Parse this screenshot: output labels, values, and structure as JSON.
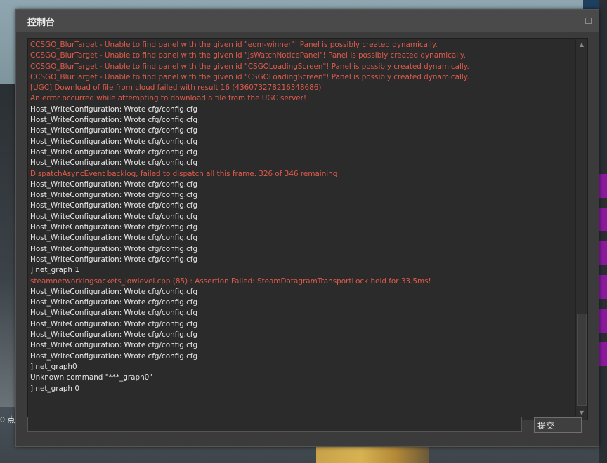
{
  "window": {
    "title": "控制台"
  },
  "log": [
    {
      "text": "CCSGO_BlurTarget - Unable to find panel with the given id \"eom-winner\"! Panel is possibly created dynamically.",
      "type": "error"
    },
    {
      "text": "CCSGO_BlurTarget - Unable to find panel with the given id \"JsWatchNoticePanel\"! Panel is possibly created dynamically.",
      "type": "error"
    },
    {
      "text": "CCSGO_BlurTarget - Unable to find panel with the given id \"CSGOLoadingScreen\"! Panel is possibly created dynamically.",
      "type": "error"
    },
    {
      "text": "CCSGO_BlurTarget - Unable to find panel with the given id \"CSGOLoadingScreen\"! Panel is possibly created dynamically.",
      "type": "error"
    },
    {
      "text": "[UGC] Download of file  from cloud failed with result 16 (436073278216348686)",
      "type": "error"
    },
    {
      "text": "An error occurred while attempting to download a file from the UGC server!",
      "type": "error"
    },
    {
      "text": "Host_WriteConfiguration: Wrote cfg/config.cfg",
      "type": "normal"
    },
    {
      "text": "Host_WriteConfiguration: Wrote cfg/config.cfg",
      "type": "normal"
    },
    {
      "text": "Host_WriteConfiguration: Wrote cfg/config.cfg",
      "type": "normal"
    },
    {
      "text": "Host_WriteConfiguration: Wrote cfg/config.cfg",
      "type": "normal"
    },
    {
      "text": "Host_WriteConfiguration: Wrote cfg/config.cfg",
      "type": "normal"
    },
    {
      "text": "Host_WriteConfiguration: Wrote cfg/config.cfg",
      "type": "normal"
    },
    {
      "text": "DispatchAsyncEvent backlog, failed to dispatch all this frame. 326 of 346 remaining",
      "type": "error"
    },
    {
      "text": "Host_WriteConfiguration: Wrote cfg/config.cfg",
      "type": "normal"
    },
    {
      "text": "Host_WriteConfiguration: Wrote cfg/config.cfg",
      "type": "normal"
    },
    {
      "text": "Host_WriteConfiguration: Wrote cfg/config.cfg",
      "type": "normal"
    },
    {
      "text": "Host_WriteConfiguration: Wrote cfg/config.cfg",
      "type": "normal"
    },
    {
      "text": "Host_WriteConfiguration: Wrote cfg/config.cfg",
      "type": "normal"
    },
    {
      "text": "Host_WriteConfiguration: Wrote cfg/config.cfg",
      "type": "normal"
    },
    {
      "text": "Host_WriteConfiguration: Wrote cfg/config.cfg",
      "type": "normal"
    },
    {
      "text": "Host_WriteConfiguration: Wrote cfg/config.cfg",
      "type": "normal"
    },
    {
      "text": "] net_graph 1",
      "type": "normal"
    },
    {
      "text": "steamnetworkingsockets_lowlevel.cpp (85) : Assertion Failed: SteamDatagramTransportLock held for 33.5ms!",
      "type": "error"
    },
    {
      "text": "Host_WriteConfiguration: Wrote cfg/config.cfg",
      "type": "normal"
    },
    {
      "text": "Host_WriteConfiguration: Wrote cfg/config.cfg",
      "type": "normal"
    },
    {
      "text": "Host_WriteConfiguration: Wrote cfg/config.cfg",
      "type": "normal"
    },
    {
      "text": "Host_WriteConfiguration: Wrote cfg/config.cfg",
      "type": "normal"
    },
    {
      "text": "Host_WriteConfiguration: Wrote cfg/config.cfg",
      "type": "normal"
    },
    {
      "text": "Host_WriteConfiguration: Wrote cfg/config.cfg",
      "type": "normal"
    },
    {
      "text": "Host_WriteConfiguration: Wrote cfg/config.cfg",
      "type": "normal"
    },
    {
      "text": "] net_graph0",
      "type": "normal"
    },
    {
      "text": "Unknown command \"***_graph0\"",
      "type": "normal"
    },
    {
      "text": "] net_graph 0",
      "type": "normal"
    }
  ],
  "colors": {
    "error": "#e05a4a",
    "normal": "#e6e6e6"
  },
  "input": {
    "value": "",
    "submit_label": "提交"
  },
  "background": {
    "left_text": "0 点"
  },
  "icons": {
    "close": "square-icon",
    "scroll_up": "triangle-up-icon",
    "scroll_down": "triangle-down-icon"
  }
}
